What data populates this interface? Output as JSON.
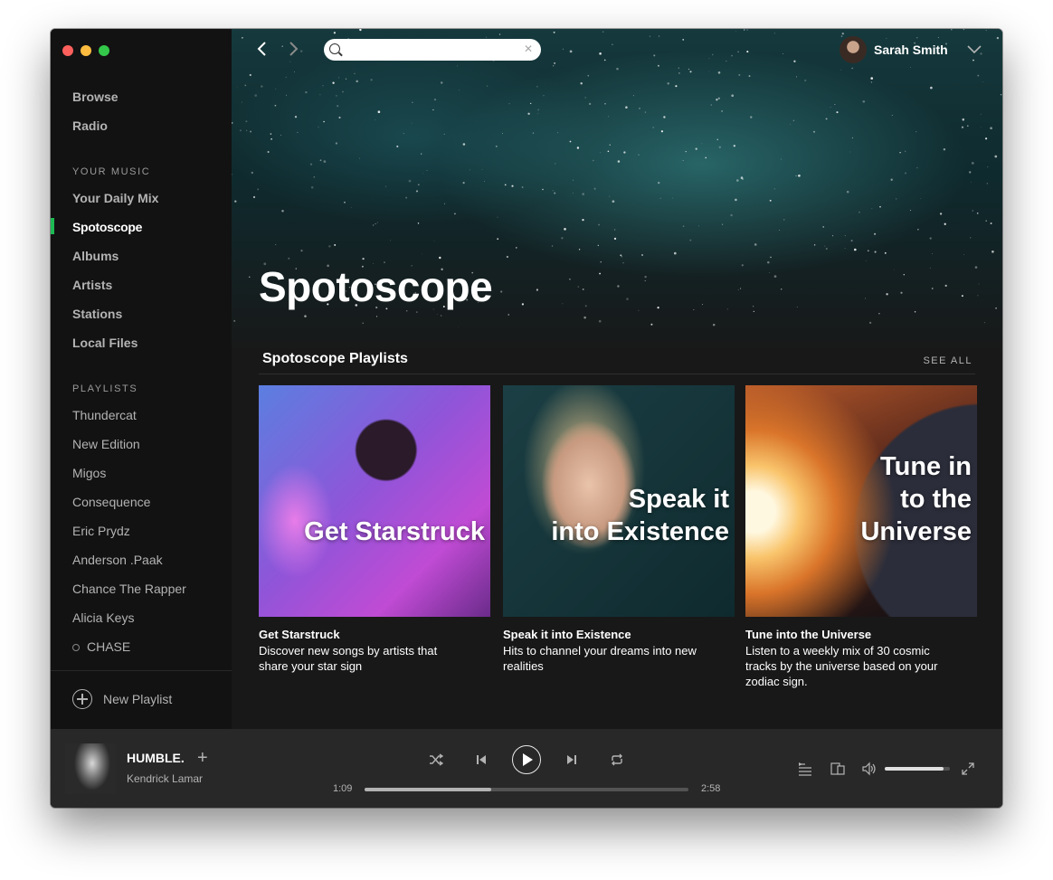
{
  "sidebar": {
    "nav": [
      {
        "label": "Browse"
      },
      {
        "label": "Radio"
      }
    ],
    "your_music": {
      "title": "YOUR MUSIC",
      "items": [
        {
          "label": "Your Daily Mix"
        },
        {
          "label": "Spotoscope",
          "active": true
        },
        {
          "label": "Albums"
        },
        {
          "label": "Artists"
        },
        {
          "label": "Stations"
        },
        {
          "label": "Local Files"
        }
      ]
    },
    "playlists": {
      "title": "PLAYLISTS",
      "items": [
        {
          "label": "Thundercat"
        },
        {
          "label": "New Edition"
        },
        {
          "label": "Migos"
        },
        {
          "label": "Consequence"
        },
        {
          "label": "Eric Prydz"
        },
        {
          "label": "Anderson .Paak"
        },
        {
          "label": "Chance The Rapper"
        },
        {
          "label": "Alicia Keys"
        },
        {
          "label": "CHASE"
        }
      ]
    },
    "new_playlist_label": "New Playlist"
  },
  "topbar": {
    "search_value": "",
    "user_name": "Sarah Smith"
  },
  "hero": {
    "title": "Spotoscope"
  },
  "section": {
    "title": "Spotoscope Playlists",
    "see_all": "SEE ALL"
  },
  "cards": [
    {
      "cover_line1": "Get Starstruck",
      "cover_line2": "",
      "cover_line3": "",
      "title": "Get Starstruck",
      "description": "Discover new songs by artists that share your star sign"
    },
    {
      "cover_line1": "Speak it",
      "cover_line2": "into Existence",
      "cover_line3": "",
      "title": "Speak it into Existence",
      "description": "Hits to channel your dreams into new realities"
    },
    {
      "cover_line1": "Tune in",
      "cover_line2": "to the",
      "cover_line3": "Universe",
      "title": "Tune into the Universe",
      "description": "Listen to a weekly mix of 30 cosmic tracks by the universe based on your zodiac sign."
    }
  ],
  "player": {
    "track": "HUMBLE.",
    "artist": "Kendrick Lamar",
    "elapsed": "1:09",
    "duration": "2:58",
    "progress": 0.39,
    "volume": 0.9
  },
  "colors": {
    "accent": "#1db954",
    "sidebar_bg": "#121212",
    "main_bg": "#181818",
    "player_bg": "#282828"
  }
}
